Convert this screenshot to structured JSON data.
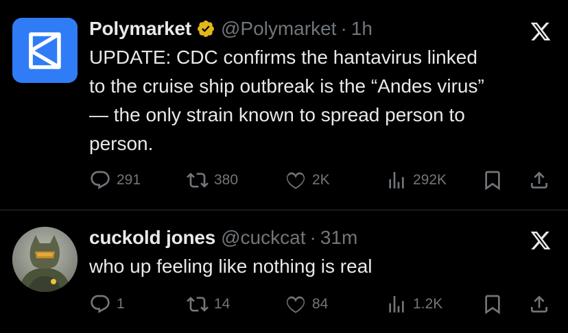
{
  "tweets": [
    {
      "author": {
        "name": "Polymarket",
        "handle": "@Polymarket",
        "verified": true,
        "avatar_icon": "polymarket-logo"
      },
      "time": "1h",
      "separator": "·",
      "lines": [
        "UPDATE: CDC confirms the hantavirus linked",
        "to the cruise ship outbreak is the “Andes virus”",
        "— the only strain known to spread person to",
        "person."
      ],
      "stats": {
        "replies": "291",
        "reposts": "380",
        "likes": "2K",
        "views": "292K"
      }
    },
    {
      "author": {
        "name": "cuckold jones",
        "handle": "@cuckcat",
        "verified": false,
        "avatar_icon": "armored-cat-avatar"
      },
      "time": "31m",
      "separator": "·",
      "lines": [
        "who up feeling like nothing is real"
      ],
      "stats": {
        "replies": "1",
        "reposts": "14",
        "likes": "84",
        "views": "1.2K"
      }
    }
  ],
  "colors": {
    "background": "#000000",
    "text": "#e7e9ea",
    "secondary": "#71767b",
    "divider": "#2f3336",
    "polymarket_blue": "#2f7cf6",
    "verified_gold": "#e2b719"
  }
}
